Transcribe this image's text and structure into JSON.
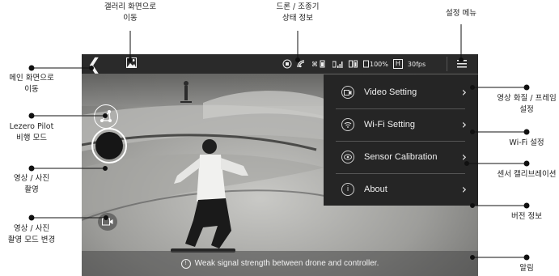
{
  "topbar": {
    "icons": [
      "back-icon",
      "gallery-icon",
      "drone-status-icon",
      "wifi-icon",
      "battery-icon",
      "signal-icon",
      "controller-battery-icon",
      "storage-icon",
      "resolution-icon",
      "settings-menu-icon"
    ],
    "battery_percent": "100%",
    "resolution_badge": "H",
    "fps": "30fps"
  },
  "menu": {
    "items": [
      {
        "label": "Video Setting",
        "icon": "video-setting-icon"
      },
      {
        "label": "Wi-Fi Setting",
        "icon": "wifi-setting-icon"
      },
      {
        "label": "Sensor Calibration",
        "icon": "sensor-calibration-icon"
      },
      {
        "label": "About",
        "icon": "info-icon"
      }
    ]
  },
  "notice": {
    "text": "Weak signal strength between drone and controller."
  },
  "callouts": {
    "gallery_line1": "갤러리 화면으로",
    "gallery_line2": "이동",
    "status_line1": "드론 / 조종기",
    "status_line2": "상태 정보",
    "settings_menu": "설정 메뉴",
    "main_line1": "메인 화면으로",
    "main_line2": "이동",
    "pilot_line1": "Lezero Pilot",
    "pilot_line2": "비행 모드",
    "shoot_line1": "영상 / 사진",
    "shoot_line2": "촬영",
    "mode_line1": "영상 / 사진",
    "mode_line2": "촬영 모드 변경",
    "video_line1": "영상 화질 / 프레임",
    "video_line2": "설정",
    "wifi": "Wi-Fi 설정",
    "sensor": "센서 캘리브레이션",
    "version": "버전 정보",
    "alert": "알림"
  },
  "colors": {
    "menu_bg": "#252525",
    "topbar_bg": "#2a2a2a",
    "callout_dot": "#111111"
  }
}
